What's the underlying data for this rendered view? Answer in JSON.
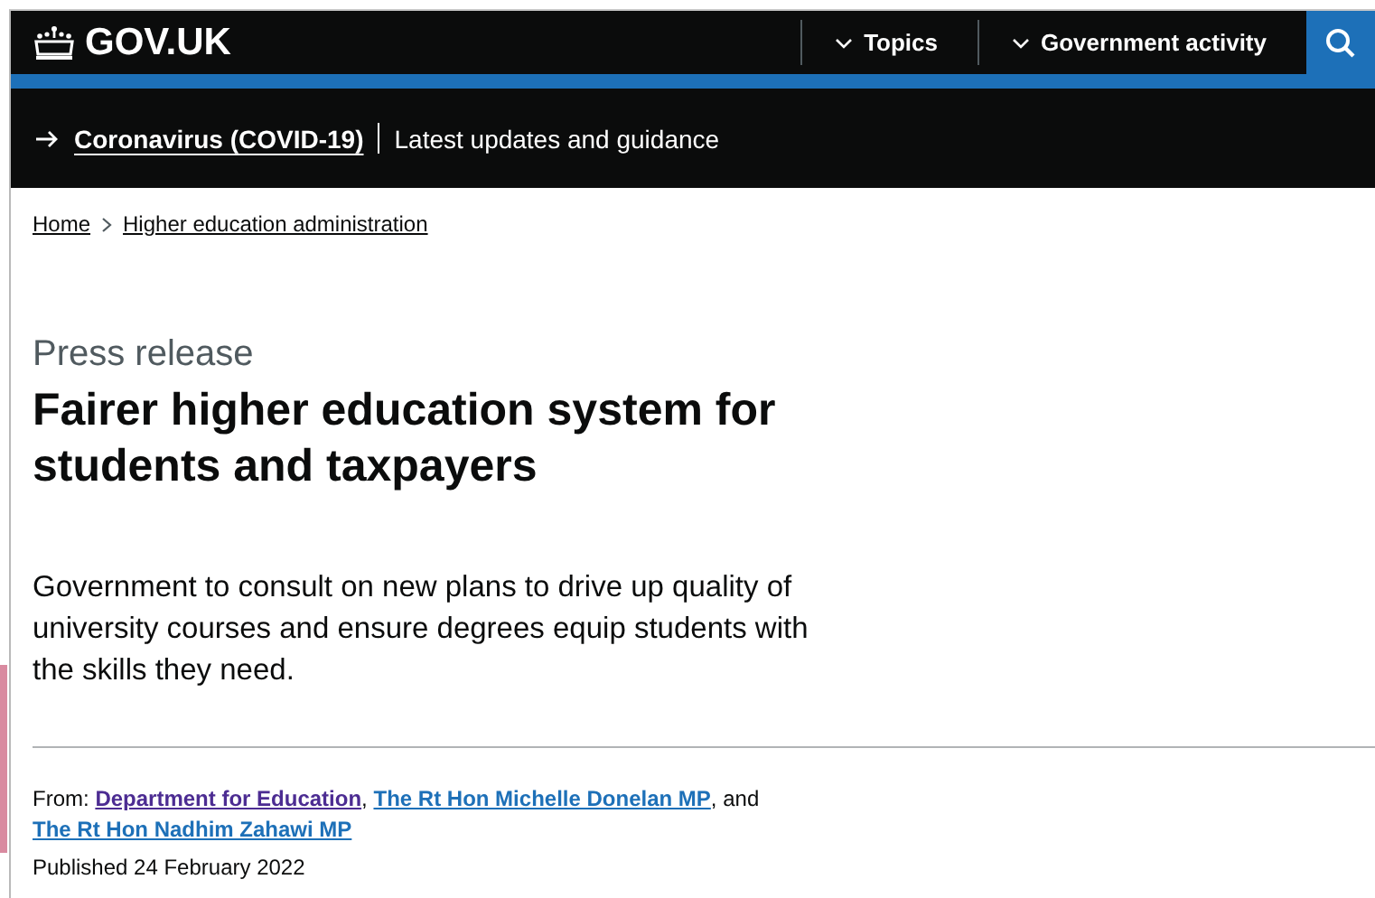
{
  "header": {
    "logo": "GOV.UK",
    "nav": [
      {
        "label": "Topics"
      },
      {
        "label": "Government activity"
      }
    ]
  },
  "banner": {
    "link": "Coronavirus (COVID-19)",
    "text": "Latest updates and guidance"
  },
  "breadcrumbs": [
    "Home",
    "Higher education administration"
  ],
  "article": {
    "type": "Press release",
    "title": "Fairer higher education system for students and taxpayers",
    "lead": "Government to consult on new plans to drive up quality of university courses and ensure degrees equip students with the skills they need."
  },
  "metadata": {
    "from_label": "From:",
    "from": [
      {
        "label": "Department for Education",
        "visited": true,
        "after": ","
      },
      {
        "label": "The Rt Hon Michelle Donelan MP",
        "visited": false,
        "after": ", and"
      },
      {
        "label": "The Rt Hon Nadhim Zahawi MP",
        "visited": false
      }
    ],
    "published": "Published 24 February 2022"
  }
}
